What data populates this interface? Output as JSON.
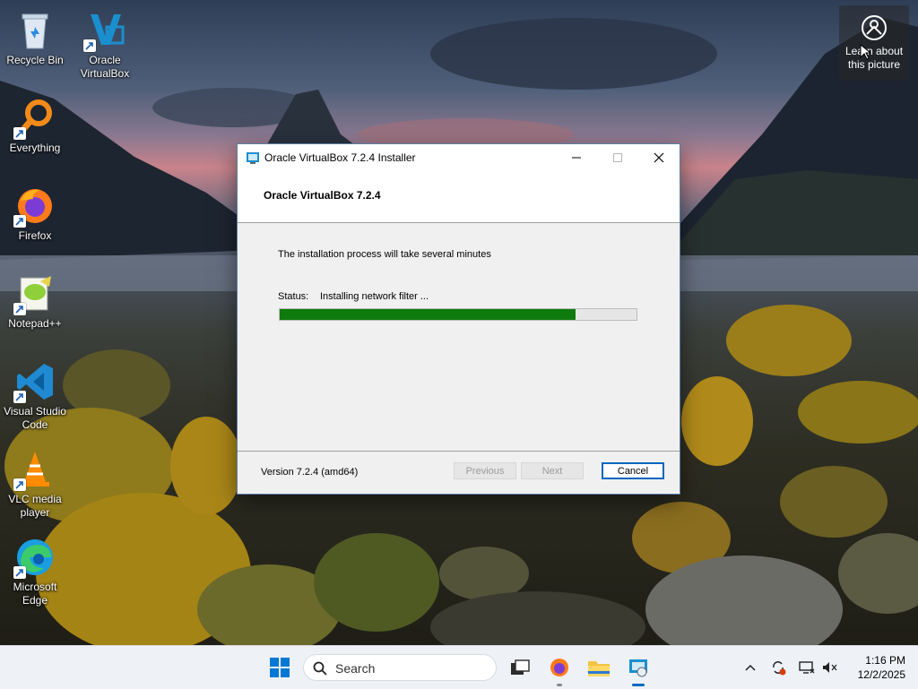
{
  "desktop": {
    "icons": [
      {
        "label": "Recycle Bin"
      },
      {
        "label": "Oracle VirtualBox"
      },
      {
        "label": "Everything"
      },
      {
        "label": "Firefox"
      },
      {
        "label": "Notepad++"
      },
      {
        "label": "Visual Studio Code"
      },
      {
        "label": "VLC media player"
      },
      {
        "label": "Microsoft Edge"
      }
    ],
    "learn_about": "Learn about this picture"
  },
  "installer": {
    "window_title": "Oracle VirtualBox 7.2.4 Installer",
    "header": "Oracle VirtualBox 7.2.4",
    "message": "The installation process will take several minutes",
    "status_label": "Status:",
    "status_text": "Installing network filter ...",
    "progress_percent": 83,
    "version": "Version 7.2.4 (amd64)",
    "buttons": {
      "previous": "Previous",
      "next": "Next",
      "cancel": "Cancel"
    }
  },
  "taskbar": {
    "search_placeholder": "Search",
    "clock_time": "1:16 PM",
    "clock_date": "12/2/2025"
  },
  "colors": {
    "progress_fill": "#0f7b0f",
    "accent": "#0067c0"
  }
}
